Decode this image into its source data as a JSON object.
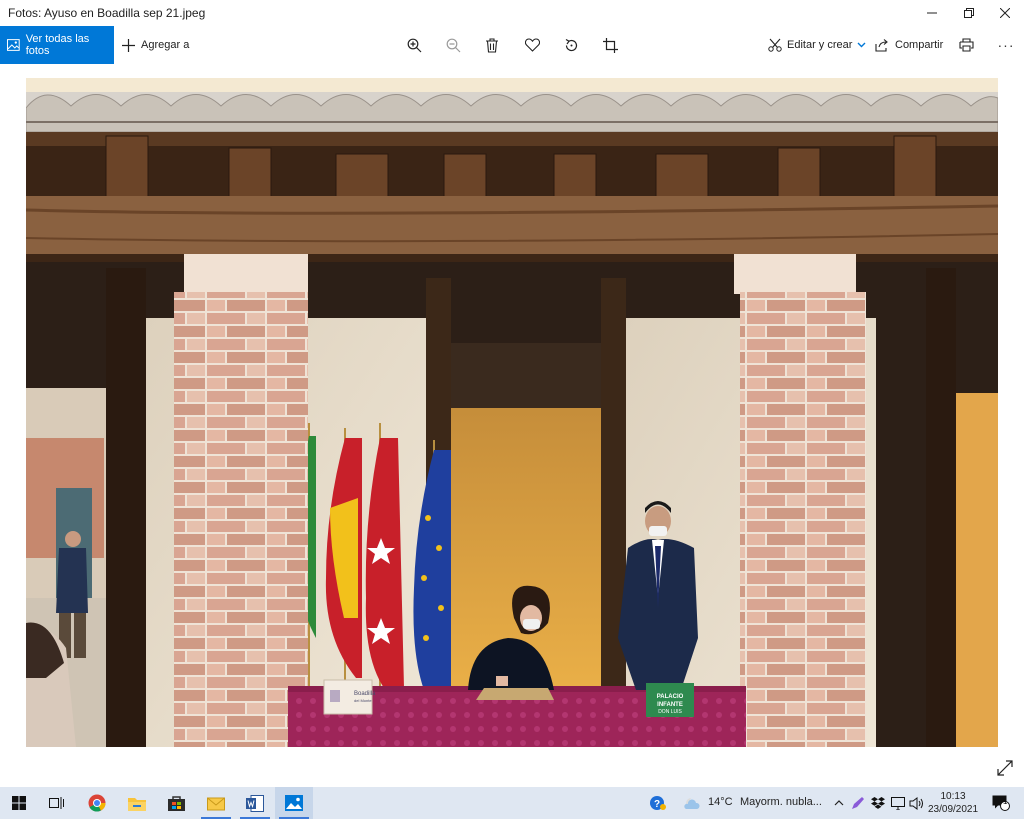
{
  "window": {
    "title": "Fotos: Ayuso en Boadilla sep 21.jpeg",
    "minimize_icon": "minimize-icon",
    "maximize_icon": "restore-icon",
    "close_icon": "close-icon"
  },
  "toolbar": {
    "view_all_label": "Ver todas las fotos",
    "add_to_label": "Agregar a",
    "edit_create_label": "Editar y crear",
    "share_label": "Compartir",
    "icons": [
      "zoom-in-icon",
      "zoom-out-icon",
      "delete-icon",
      "heart-icon",
      "rotate-icon",
      "crop-icon",
      "print-icon",
      "more-icon"
    ],
    "accent": "#0078d7"
  },
  "photo": {
    "sign_left_line1": "Boadilla",
    "sign_left_line2": "del Monte",
    "sign_right_line1": "PALACIO",
    "sign_right_line2": "INFANTE",
    "sign_right_line3": "DON LUIS"
  },
  "taskbar": {
    "weather_temp": "14°C",
    "weather_desc": "Mayorm. nubla...",
    "time": "10:13",
    "date": "23/09/2021",
    "notification_count": "1",
    "apps": [
      "windows-start-icon",
      "task-view-icon",
      "chrome-icon",
      "file-explorer-icon",
      "store-icon",
      "mail-icon",
      "word-icon",
      "photos-icon"
    ]
  }
}
